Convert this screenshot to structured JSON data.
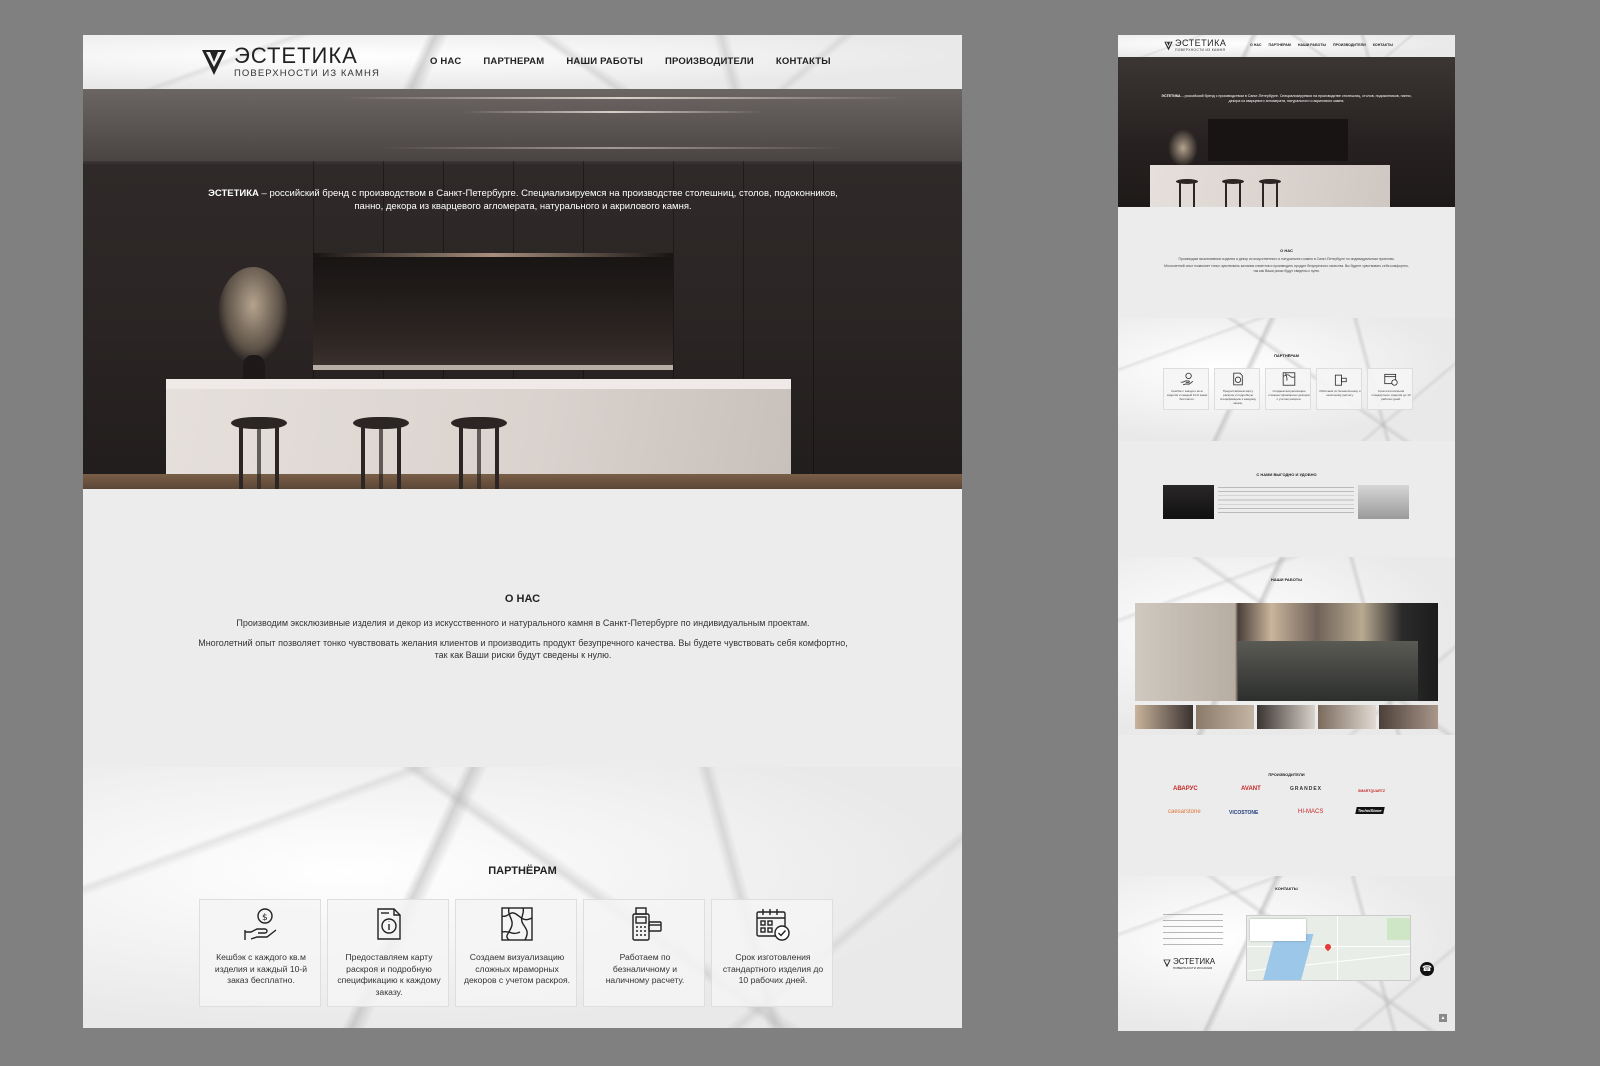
{
  "brand": {
    "name": "ЭСТЕТИКА",
    "tagline": "ПОВЕРХНОСТИ ИЗ КАМНЯ"
  },
  "nav": [
    "О НАС",
    "ПАРТНЕРАМ",
    "НАШИ РАБОТЫ",
    "ПРОИЗВОДИТЕЛИ",
    "КОНТАКТЫ"
  ],
  "hero": {
    "brand_word": "ЭСТЕТИКА",
    "text": " – российский бренд с производством в Санкт-Петербурге. Специализируемся на производстве столешниц, столов, подоконников, панно, декора из кварцевого агломерата, натурального и акрилового камня."
  },
  "about": {
    "title": "О НАС",
    "p1": "Производим эксклюзивные изделия и декор из искусственного и натурального камня в Санкт-Петербурге по индивидуальным проектам.",
    "p2": "Многолетний опыт позволяет тонко чувствовать желания клиентов и производить продукт безупречного качества. Вы будете чувствовать себя комфортно, так как Ваши риски будут сведены к нулю."
  },
  "partners": {
    "title": "ПАРТНЁРАМ",
    "cards": [
      {
        "icon": "cashback-hand-icon",
        "text": "Кешбэк с каждого кв.м изделия и каждый 10-й заказ бесплатно."
      },
      {
        "icon": "document-info-icon",
        "text": "Предоставляем карту раскроя и подробную спецификацию к каждому заказу."
      },
      {
        "icon": "marble-pattern-icon",
        "text": "Создаем визуализацию сложных мраморных декоров с учетом раскроя."
      },
      {
        "icon": "payment-terminal-icon",
        "text": "Работаем по безналичному и наличному расчету."
      },
      {
        "icon": "calendar-check-icon",
        "text": "Срок изготовления стандартного изделия до 10 рабочих дней."
      }
    ]
  },
  "mobile": {
    "nav": [
      "О НАС",
      "ПАРТНЕРАМ",
      "НАШИ РАБОТЫ",
      "ПРОИЗВОДИТЕЛИ",
      "КОНТАКТЫ"
    ],
    "about_title": "О НАС",
    "partners_title": "ПАРТНЁРАМ",
    "benefits_title": "С НАМИ ВЫГОДНО И УДОБНО",
    "works_title": "НАШИ РАБОТЫ",
    "makers_title": "ПРОИЗВОДИТЕЛИ",
    "contacts_title": "КОНТАКТЫ",
    "brands": [
      {
        "name": "АВАРУС",
        "color": "#c62828"
      },
      {
        "name": "AVANT",
        "color": "#c62828"
      },
      {
        "name": "GRANDEX",
        "color": "#333333"
      },
      {
        "name": "SMARTQUARTZ",
        "color": "#c62828"
      },
      {
        "name": "caesarstone",
        "color": "#e0763a"
      },
      {
        "name": "VICOSTONE",
        "color": "#1f3b7a"
      },
      {
        "name": "HI-MACS",
        "color": "#c62828"
      },
      {
        "name": "TechniStone",
        "color": "#111111"
      }
    ]
  },
  "colors": {
    "background": "#808080",
    "page": "#ececec",
    "hero_dark": "#2a2524",
    "text": "#222222"
  }
}
